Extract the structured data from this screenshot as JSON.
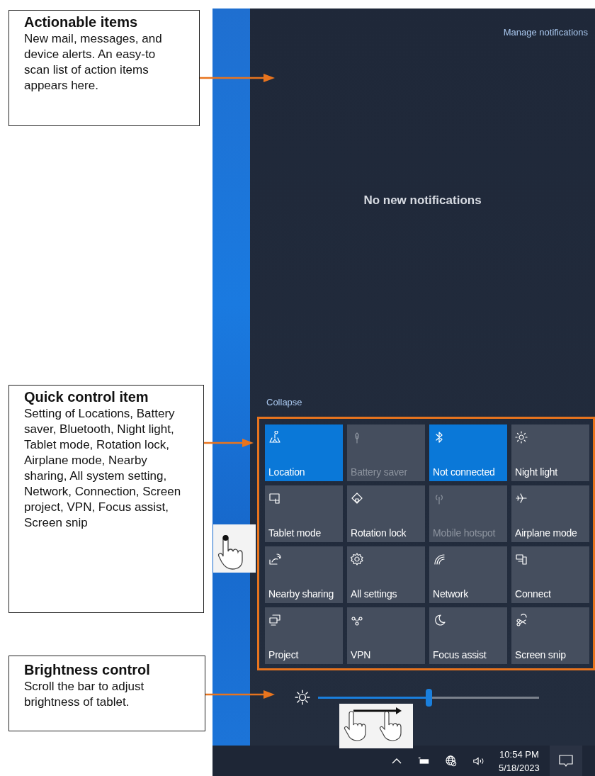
{
  "callouts": [
    {
      "title": "Actionable items",
      "text": "New mail, messages, and device alerts. An easy-to scan list of action items appears here."
    },
    {
      "title": "Quick control item",
      "text": "Setting of Locations, Battery saver, Bluetooth, Night light, Tablet mode, Rotation lock, Airplane mode, Nearby sharing, All system setting, Network, Connection, Screen project, VPN, Focus assist, Screen snip"
    },
    {
      "title": "Brightness control",
      "text": "Scroll the bar to adjust brightness of tablet."
    }
  ],
  "action_center": {
    "manage_link": "Manage notifications",
    "empty_message": "No new notifications",
    "collapse_link": "Collapse",
    "tiles": [
      {
        "label": "Location",
        "on": true,
        "disabled": false
      },
      {
        "label": "Battery saver",
        "on": false,
        "disabled": true
      },
      {
        "label": "Not connected",
        "on": true,
        "disabled": false
      },
      {
        "label": "Night light",
        "on": false,
        "disabled": false
      },
      {
        "label": "Tablet mode",
        "on": false,
        "disabled": false
      },
      {
        "label": "Rotation lock",
        "on": false,
        "disabled": false
      },
      {
        "label": "Mobile hotspot",
        "on": false,
        "disabled": true
      },
      {
        "label": "Airplane mode",
        "on": false,
        "disabled": false
      },
      {
        "label": "Nearby sharing",
        "on": false,
        "disabled": false
      },
      {
        "label": "All settings",
        "on": false,
        "disabled": false
      },
      {
        "label": "Network",
        "on": false,
        "disabled": false
      },
      {
        "label": "Connect",
        "on": false,
        "disabled": false
      },
      {
        "label": "Project",
        "on": false,
        "disabled": false
      },
      {
        "label": "VPN",
        "on": false,
        "disabled": false
      },
      {
        "label": "Focus assist",
        "on": false,
        "disabled": false
      },
      {
        "label": "Screen snip",
        "on": false,
        "disabled": false
      }
    ],
    "brightness": {
      "level": 0.5
    }
  },
  "taskbar": {
    "time": "10:54 PM",
    "date": "5/18/2023"
  }
}
